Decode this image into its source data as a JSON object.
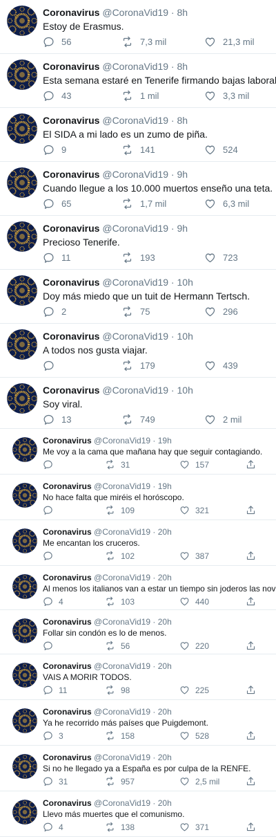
{
  "colors": {
    "text": "#14171a",
    "muted": "#657786",
    "divider": "#e6ecf0",
    "avatar_bg": "#0d1d4a",
    "virus": "#d7a437"
  },
  "icons": [
    "reply-icon",
    "retweet-icon",
    "like-icon",
    "share-icon"
  ],
  "tweets": [
    {
      "name": "Coronavirus",
      "handle": "@CoronaVid19",
      "time": "8h",
      "text": "Estoy de Erasmus.",
      "replies": "56",
      "retweets": "7,3 mil",
      "likes": "21,3 mil"
    },
    {
      "name": "Coronavirus",
      "handle": "@CoronaVid19",
      "time": "8h",
      "text": "Esta semana estaré en Tenerife firmando bajas laborales.",
      "replies": "43",
      "retweets": "1 mil",
      "likes": "3,3 mil"
    },
    {
      "name": "Coronavirus",
      "handle": "@CoronaVid19",
      "time": "8h",
      "text": "El SIDA a mi lado es un zumo de piña.",
      "replies": "9",
      "retweets": "141",
      "likes": "524"
    },
    {
      "name": "Coronavirus",
      "handle": "@CoronaVid19",
      "time": "9h",
      "text": "Cuando llegue a los 10.000 muertos enseño una teta.",
      "replies": "65",
      "retweets": "1,7 mil",
      "likes": "6,3 mil"
    },
    {
      "name": "Coronavirus",
      "handle": "@CoronaVid19",
      "time": "9h",
      "text": "Precioso Tenerife.",
      "replies": "11",
      "retweets": "193",
      "likes": "723"
    },
    {
      "name": "Coronavirus",
      "handle": "@CoronaVid19",
      "time": "10h",
      "text": "Doy más miedo que un tuit de Hermann Tertsch.",
      "replies": "2",
      "retweets": "75",
      "likes": "296"
    },
    {
      "name": "Coronavirus",
      "handle": "@CoronaVid19",
      "time": "10h",
      "text": "A todos nos gusta viajar.",
      "replies": "",
      "retweets": "179",
      "likes": "439"
    },
    {
      "name": "Coronavirus",
      "handle": "@CoronaVid19",
      "time": "10h",
      "text": "Soy viral.",
      "replies": "13",
      "retweets": "749",
      "likes": "2 mil"
    },
    {
      "name": "Coronavirus",
      "handle": "@CoronaVid19",
      "time": "19h",
      "text": "Me voy a la cama que mañana hay que seguir contagiando.",
      "replies": "",
      "retweets": "31",
      "likes": "157"
    },
    {
      "name": "Coronavirus",
      "handle": "@CoronaVid19",
      "time": "19h",
      "text": "No hace falta que miréis el horóscopo.",
      "replies": "",
      "retweets": "109",
      "likes": "321"
    },
    {
      "name": "Coronavirus",
      "handle": "@CoronaVid19",
      "time": "20h",
      "text": "Me encantan los cruceros.",
      "replies": "",
      "retweets": "102",
      "likes": "387"
    },
    {
      "name": "Coronavirus",
      "handle": "@CoronaVid19",
      "time": "20h",
      "text": "Al menos los italianos van a estar un tiempo sin joderos las novias.",
      "replies": "4",
      "retweets": "103",
      "likes": "440"
    },
    {
      "name": "Coronavirus",
      "handle": "@CoronaVid19",
      "time": "20h",
      "text": "Follar sin condón es lo de menos.",
      "replies": "",
      "retweets": "56",
      "likes": "220"
    },
    {
      "name": "Coronavirus",
      "handle": "@CoronaVid19",
      "time": "20h",
      "text": "VAIS A MORIR TODOS.",
      "replies": "11",
      "retweets": "98",
      "likes": "225"
    },
    {
      "name": "Coronavirus",
      "handle": "@CoronaVid19",
      "time": "20h",
      "text": "Ya he recorrido más países que Puigdemont.",
      "replies": "3",
      "retweets": "158",
      "likes": "528"
    },
    {
      "name": "Coronavirus",
      "handle": "@CoronaVid19",
      "time": "20h",
      "text": "Si no he llegado ya a España es por culpa de la RENFE.",
      "replies": "31",
      "retweets": "957",
      "likes": "2,5 mil"
    },
    {
      "name": "Coronavirus",
      "handle": "@CoronaVid19",
      "time": "20h",
      "text": "Llevo más muertes que el comunismo.",
      "replies": "4",
      "retweets": "138",
      "likes": "371"
    }
  ]
}
